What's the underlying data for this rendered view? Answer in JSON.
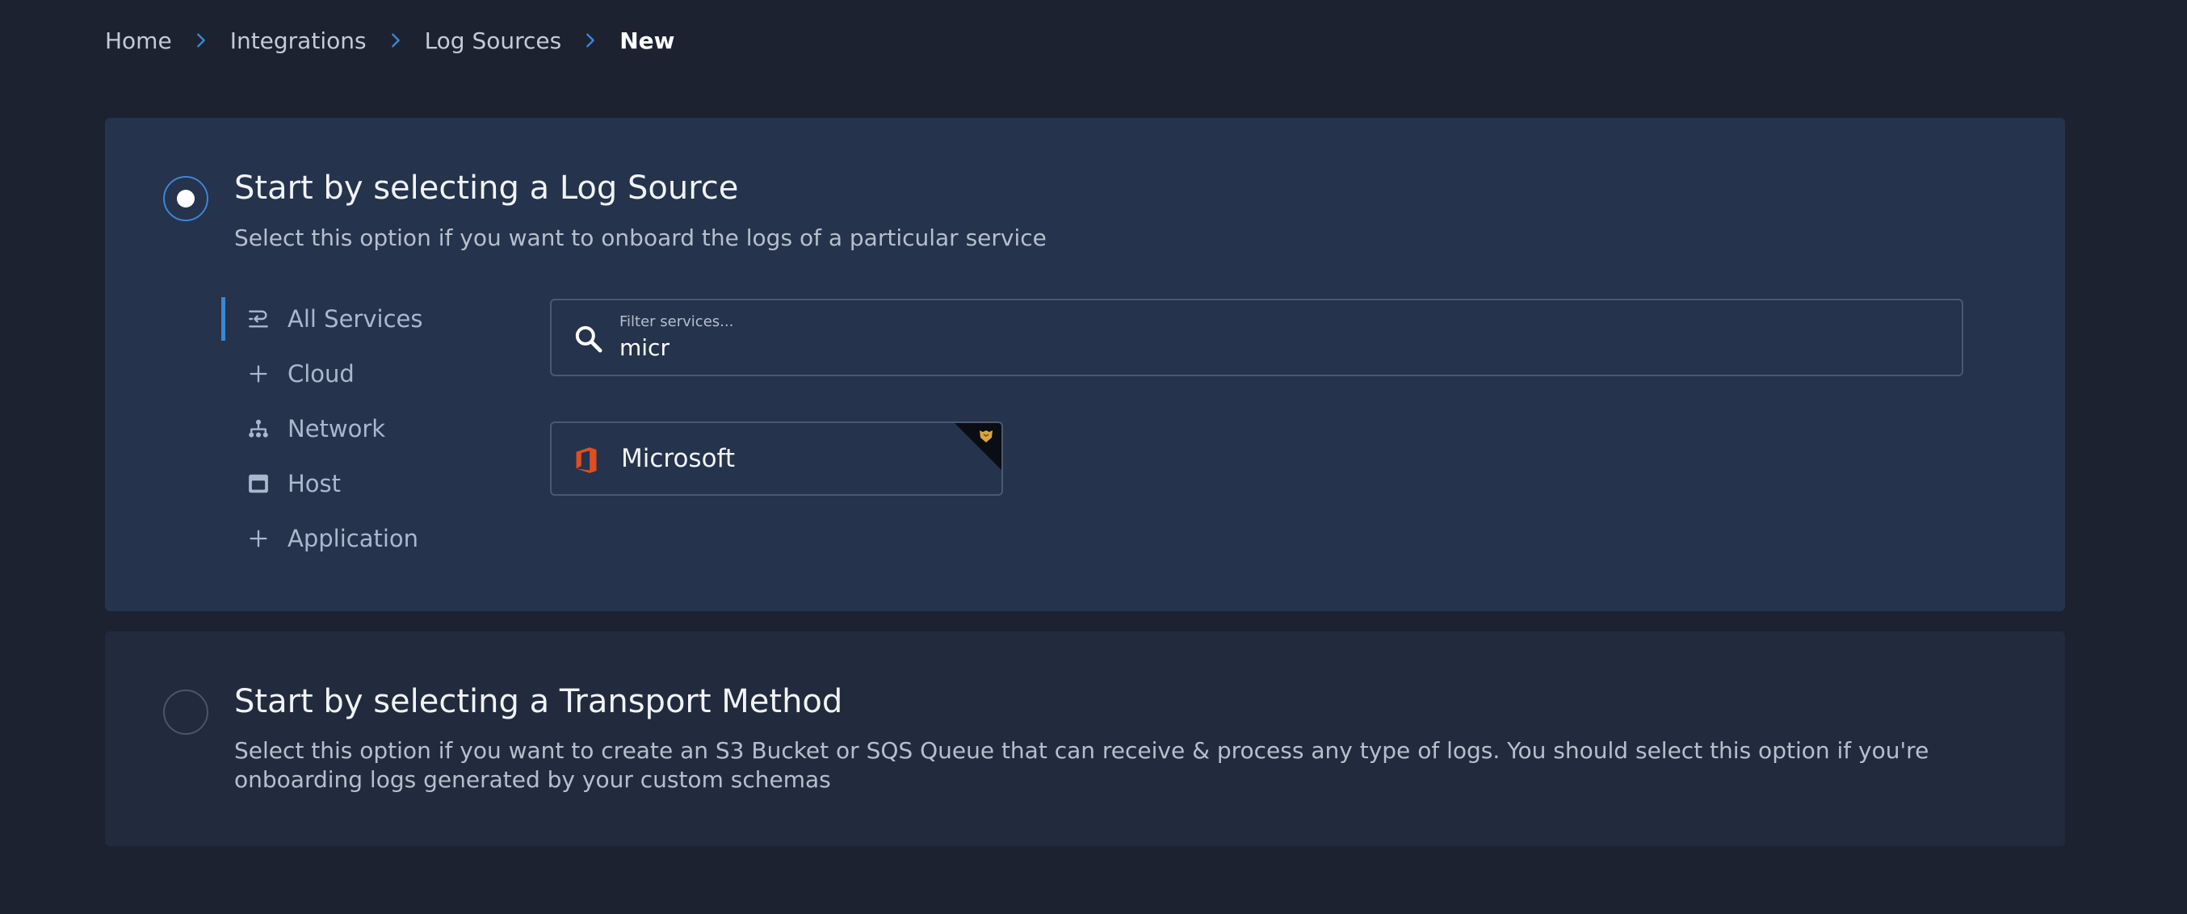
{
  "breadcrumb": {
    "items": [
      "Home",
      "Integrations",
      "Log Sources"
    ],
    "current": "New"
  },
  "log_source_option": {
    "title": "Start by selecting a Log Source",
    "description": "Select this option if you want to onboard the logs of a particular service",
    "selected": true
  },
  "categories": [
    {
      "label": "All Services",
      "icon": "all-services-icon",
      "active": true
    },
    {
      "label": "Cloud",
      "icon": "plus-icon",
      "active": false
    },
    {
      "label": "Network",
      "icon": "network-icon",
      "active": false
    },
    {
      "label": "Host",
      "icon": "host-icon",
      "active": false
    },
    {
      "label": "Application",
      "icon": "plus-icon",
      "active": false
    }
  ],
  "search": {
    "label": "Filter services...",
    "value": "micr"
  },
  "results": [
    {
      "name": "Microsoft",
      "icon": "microsoft-office-icon",
      "badge": "panther-badge-icon"
    }
  ],
  "transport_option": {
    "title": "Start by selecting a Transport Method",
    "description": "Select this option if you want to create an S3 Bucket or SQS Queue that can receive & process any type of logs. You should select this option if you're onboarding logs generated by your custom schemas",
    "selected": false
  },
  "colors": {
    "background": "#1c2230",
    "panel_active": "#25334c",
    "panel_inactive": "#222b3e",
    "accent": "#3e85d6",
    "microsoft_orange": "#e04e20"
  }
}
